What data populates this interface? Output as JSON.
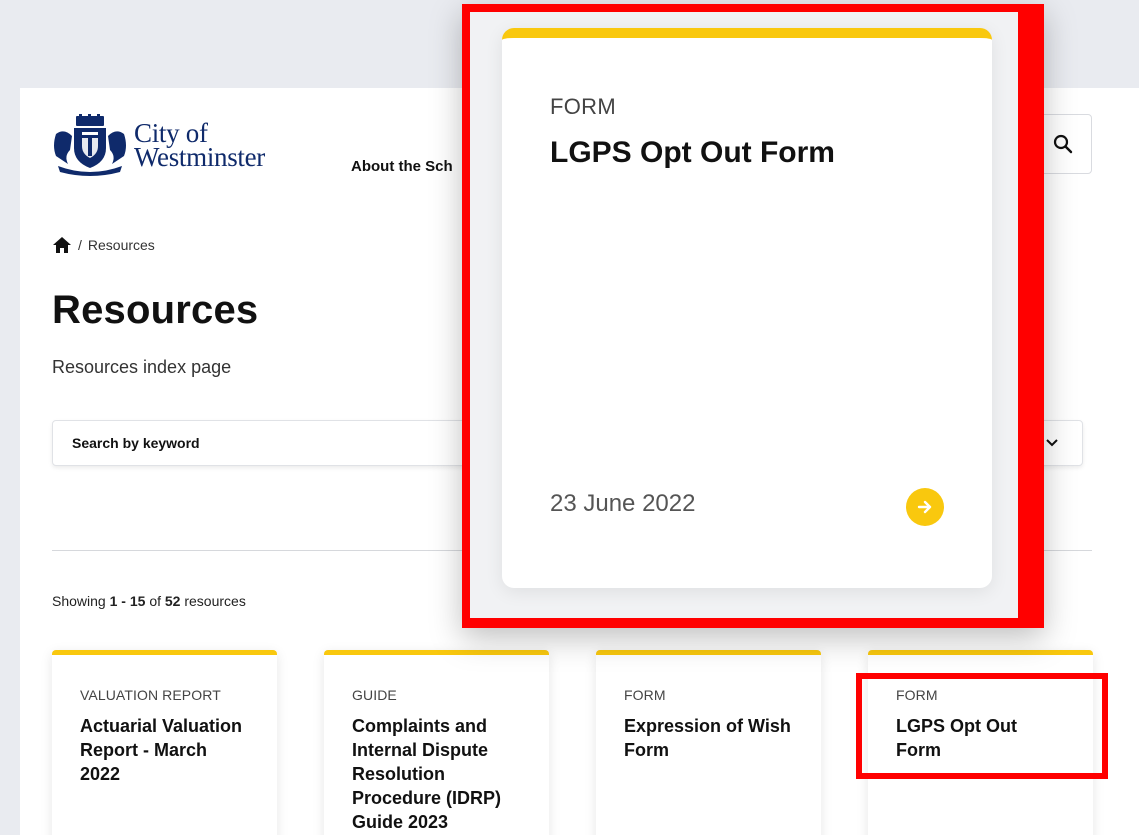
{
  "header": {
    "logo_line1": "City of",
    "logo_line2": "Westminster",
    "nav_about": "About the Sch",
    "search_icon": "search-icon"
  },
  "breadcrumb": {
    "home_icon": "home-icon",
    "separator": "/",
    "current": "Resources"
  },
  "main": {
    "title": "Resources",
    "subtitle": "Resources index page",
    "search_placeholder": "Search by keyword",
    "sort_icon": "chevron-down-icon",
    "results": {
      "prefix": "Showing",
      "from": "1",
      "dash": "-",
      "to": "15",
      "of": "of",
      "total": "52",
      "suffix": "resources"
    },
    "cards": [
      {
        "type": "VALUATION REPORT",
        "title": "Actuarial Valuation Report - March 2022"
      },
      {
        "type": "GUIDE",
        "title": "Complaints and Internal Dispute Resolution Procedure (IDRP) Guide 2023"
      },
      {
        "type": "FORM",
        "title": "Expression of Wish Form"
      },
      {
        "type": "FORM",
        "title": "LGPS Opt Out Form"
      }
    ]
  },
  "zoom": {
    "type": "FORM",
    "title": "LGPS Opt Out Form",
    "date": "23 June 2022",
    "arrow_icon": "arrow-right-icon"
  },
  "colors": {
    "accent": "#f9c80e",
    "highlight": "#ff0000",
    "brand": "#0f2a6b"
  }
}
